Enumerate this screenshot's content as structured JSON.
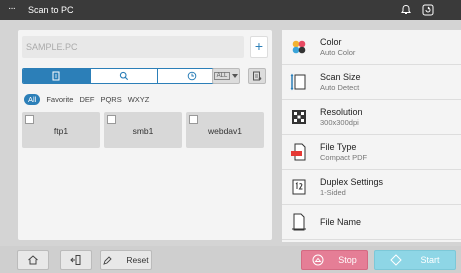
{
  "titlebar": {
    "menu_glyph": "···",
    "title": "Scan to PC"
  },
  "host": {
    "placeholder": "SAMPLE.PC",
    "add_label": "+"
  },
  "filter_button": {
    "label": "ALL"
  },
  "letter_tabs": [
    "All",
    "Favorite",
    "DEF",
    "PQRS",
    "WXYZ"
  ],
  "destinations": [
    "ftp1",
    "smb1",
    "webdav1"
  ],
  "settings": [
    {
      "name": "Color",
      "value": "Auto Color"
    },
    {
      "name": "Scan Size",
      "value": "Auto Detect"
    },
    {
      "name": "Resolution",
      "value": "300x300dpi"
    },
    {
      "name": "File Type",
      "value": "Compact PDF"
    },
    {
      "name": "Duplex Settings",
      "value": "1-Sided"
    },
    {
      "name": "File Name",
      "value": ""
    }
  ],
  "bottom": {
    "reset_label": "Reset",
    "stop_label": "Stop",
    "start_label": "Start"
  },
  "colors": {
    "accent": "#2c7fb8",
    "stop": "#e57e96",
    "start": "#8ed6e6"
  }
}
